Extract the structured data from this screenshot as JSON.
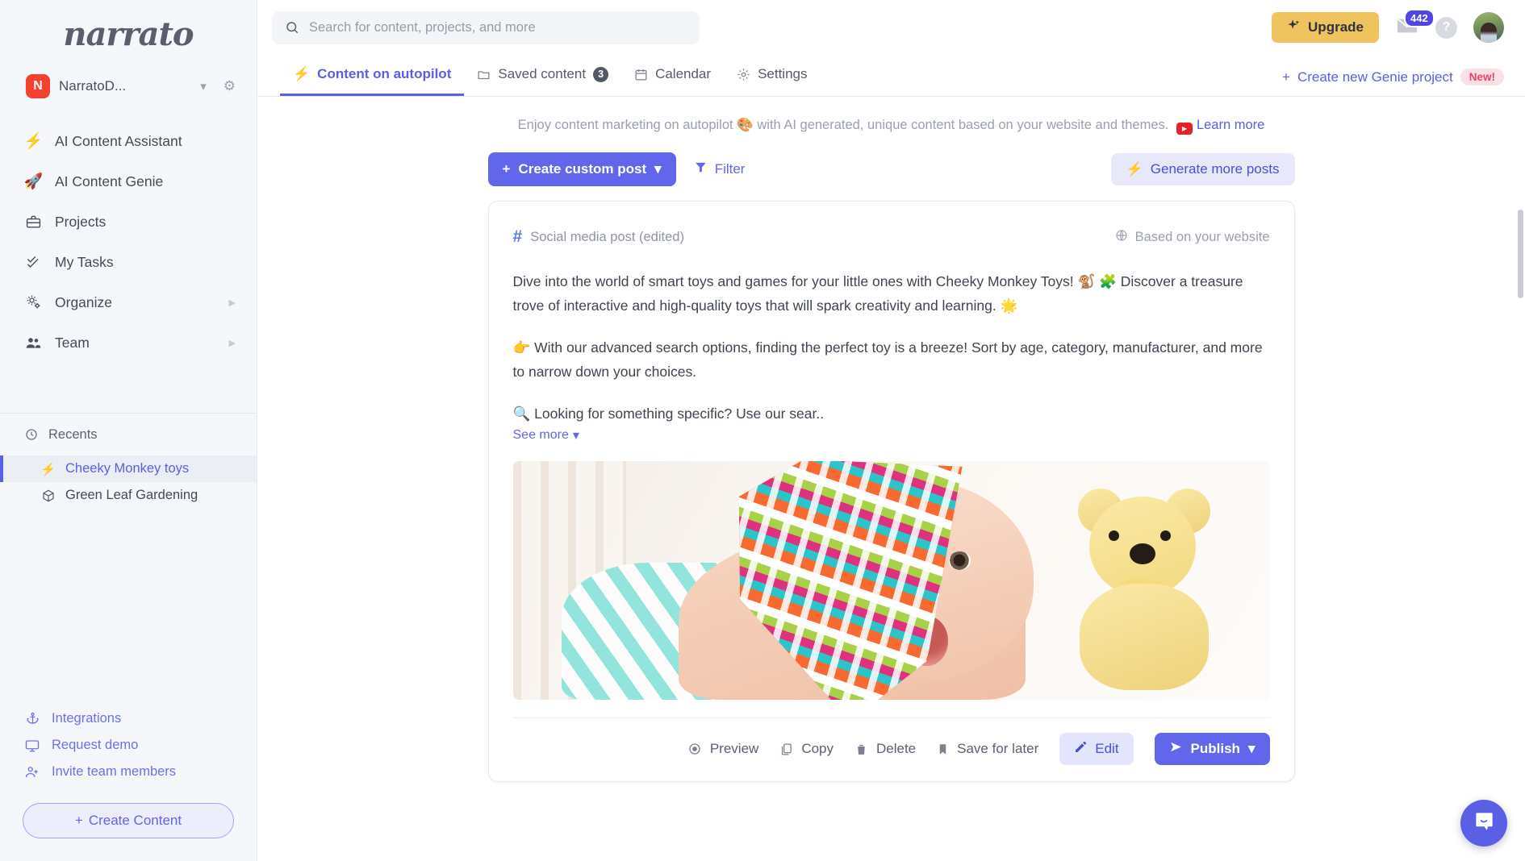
{
  "brand": {
    "logo_text": "narrato",
    "accent": "#6166ea",
    "upgrade_color": "#efc45e"
  },
  "workspace": {
    "initial": "N",
    "name": "NarratoD...",
    "chevron": "⌄",
    "gear": "⚙"
  },
  "sidebar": {
    "items": [
      {
        "label": "AI Content Assistant",
        "icon": "⚡",
        "icon_name": "lightning-icon",
        "caret": ""
      },
      {
        "label": "AI Content Genie",
        "icon": "🚀",
        "icon_name": "rocket-icon",
        "caret": ""
      },
      {
        "label": "Projects",
        "icon": "💼",
        "icon_name": "briefcase-icon",
        "caret": ""
      },
      {
        "label": "My Tasks",
        "icon": "✓",
        "icon_name": "checklist-icon",
        "caret": ""
      },
      {
        "label": "Organize",
        "icon": "⚙",
        "icon_name": "gears-icon",
        "caret": "▶"
      },
      {
        "label": "Team",
        "icon": "👥",
        "icon_name": "people-icon",
        "caret": "▶"
      }
    ],
    "recents": {
      "title": "Recents",
      "icon": "🕒",
      "items": [
        {
          "label": "Cheeky Monkey toys",
          "icon": "⚡",
          "active": true
        },
        {
          "label": "Green Leaf Gardening",
          "icon": "📦",
          "active": false
        }
      ]
    },
    "footer": [
      {
        "label": "Integrations",
        "icon": "⚓"
      },
      {
        "label": "Request demo",
        "icon": "🖥"
      },
      {
        "label": "Invite team members",
        "icon": "👤"
      }
    ],
    "create_content_label": "Create Content",
    "create_content_plus": "+"
  },
  "header": {
    "search": {
      "placeholder": "Search for content, projects, and more",
      "value": "",
      "icon": "search-icon"
    },
    "upgrade_label": "Upgrade",
    "upgrade_icon": "✨",
    "mail_badge": "442",
    "help_label": "?"
  },
  "tabs": [
    {
      "label": "Content on autopilot",
      "icon": "⚡",
      "active": true,
      "badge": ""
    },
    {
      "label": "Saved content",
      "icon": "🗁",
      "active": false,
      "badge": "3"
    },
    {
      "label": "Calendar",
      "icon": "📅",
      "active": false,
      "badge": ""
    },
    {
      "label": "Settings",
      "icon": "⚙",
      "active": false,
      "badge": ""
    }
  ],
  "genie_cta": {
    "plus": "+",
    "label": "Create new Genie project",
    "badge": "New!"
  },
  "banner": {
    "text_before": "Enjoy content marketing on autopilot",
    "emoji": "🎨",
    "text_after": "with AI generated, unique content based on your website and themes.",
    "link": "Learn more"
  },
  "toolbar": {
    "create_post_label": "Create custom post",
    "create_post_plus": "+",
    "create_post_chevron": "⌄",
    "filter_label": "Filter",
    "generate_label": "Generate more posts",
    "generate_icon": "⚡"
  },
  "post": {
    "type_icon": "#",
    "type_label": "Social media post (edited)",
    "source_icon": "🌐",
    "source_label": "Based on your website",
    "paragraphs": [
      "Dive into the world of smart toys and games for your little ones with Cheeky Monkey Toys! 🐒 🧩 Discover a treasure trove of interactive and high-quality toys that will spark creativity and learning. 🌟",
      "👉 With our advanced search options, finding the perfect toy is a breeze! Sort by age, category, manufacturer, and more to narrow down your choices.",
      "🔍 Looking for something specific? Use our sear.."
    ],
    "see_more": "See more",
    "see_more_chevron": "⌄",
    "image_alt": "Baby wearing an orange patterned scarf beside a yellow teddy bear",
    "actions": [
      {
        "label": "Preview",
        "icon": "◎"
      },
      {
        "label": "Copy",
        "icon": "❐"
      },
      {
        "label": "Delete",
        "icon": "🗑"
      },
      {
        "label": "Save for later",
        "icon": "🔖"
      }
    ],
    "edit_label": "Edit",
    "edit_icon": "✎",
    "publish_label": "Publish",
    "publish_icon": "➤",
    "publish_chevron": "⌄"
  }
}
